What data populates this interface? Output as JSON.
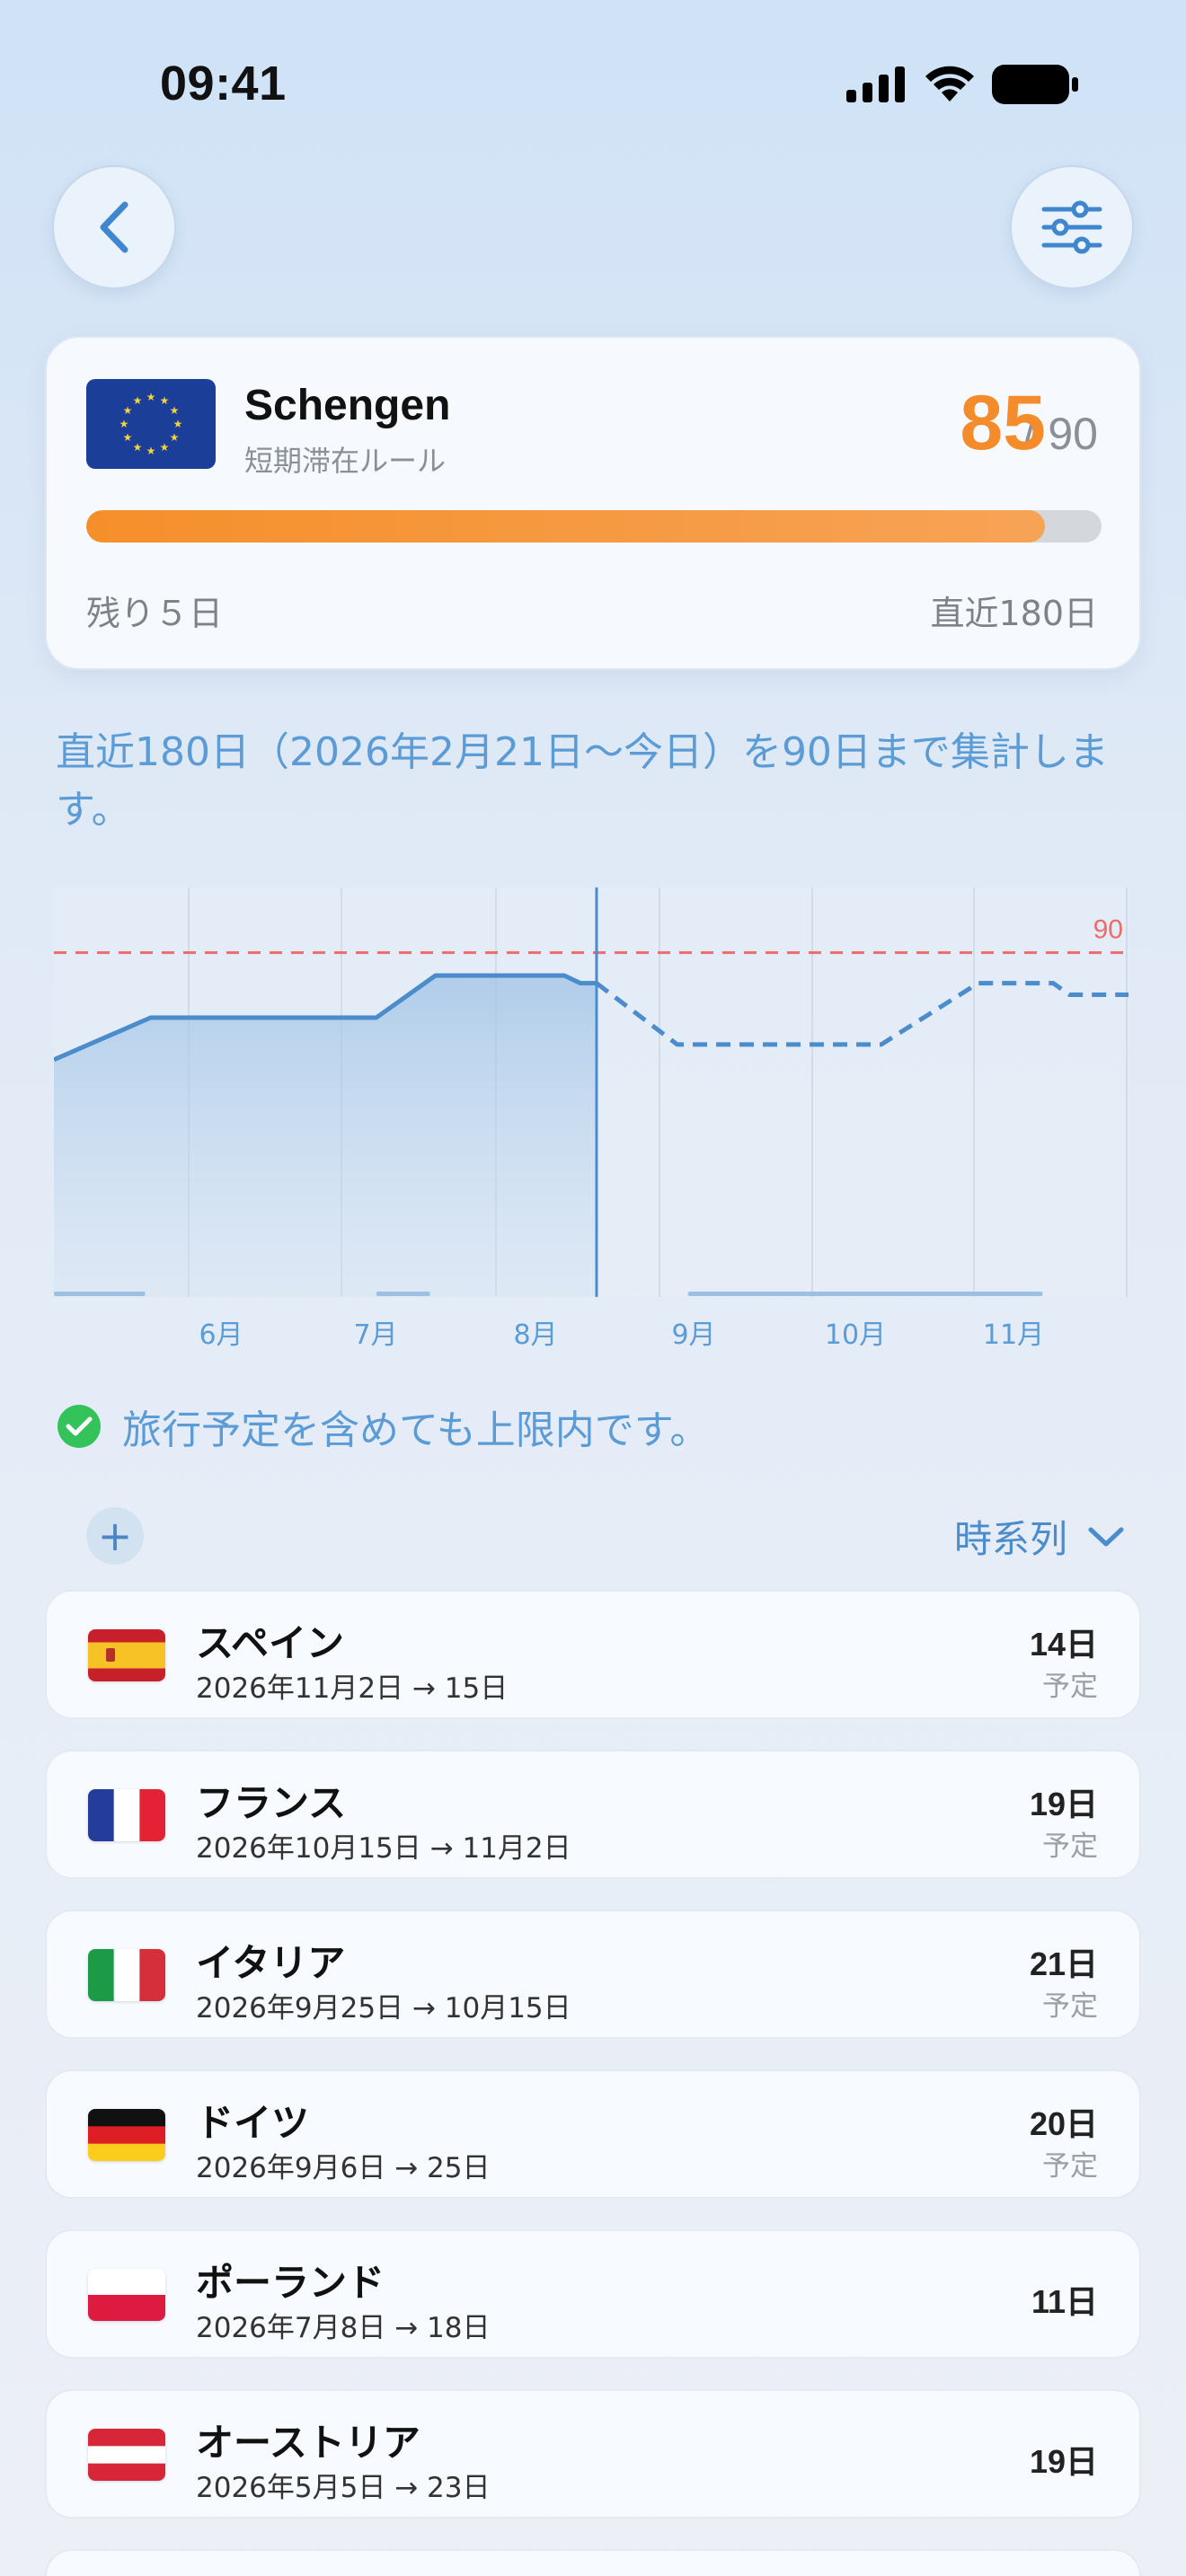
{
  "status_bar": {
    "time": "09:41"
  },
  "nav": {
    "back_icon": "chevron-left-icon",
    "filter_icon": "sliders-icon"
  },
  "summary": {
    "title": "Schengen",
    "subtitle": "短期滞在ルール",
    "used": "85",
    "total": "/ 90",
    "progress_fraction": 0.944,
    "remaining": "残り５日",
    "window": "直近180日",
    "accent_color": "#f48c2b"
  },
  "description": "直近180日（2026年2月21日〜今日）を90日まで集計します。",
  "chart_data": {
    "type": "line",
    "x_labels": [
      "6月",
      "7月",
      "8月",
      "9月",
      "10月",
      "11月"
    ],
    "limit": {
      "value": 90,
      "label": "90",
      "color": "#ec6b6b"
    },
    "today_marker": "today",
    "series": [
      {
        "kind": "actual",
        "style": "solid-filled",
        "color": "#4a8ccc",
        "points": [
          [
            0,
            62
          ],
          [
            0.09,
            73
          ],
          [
            0.3,
            73
          ],
          [
            0.355,
            84
          ],
          [
            0.475,
            84
          ],
          [
            0.49,
            82
          ],
          [
            0.505,
            82
          ]
        ]
      },
      {
        "kind": "projected",
        "style": "dashed",
        "color": "#4a8ccc",
        "points": [
          [
            0.505,
            82
          ],
          [
            0.58,
            66
          ],
          [
            0.77,
            66
          ],
          [
            0.86,
            82
          ],
          [
            0.93,
            82
          ],
          [
            0.945,
            79
          ],
          [
            1.0,
            79
          ]
        ]
      }
    ],
    "ylim": [
      0,
      100
    ],
    "trip_bars": [
      [
        0,
        0.085
      ],
      [
        0.3,
        0.35
      ],
      [
        0.59,
        0.92
      ]
    ]
  },
  "check": {
    "icon": "check-circle-icon",
    "text": "旅行予定を含めても上限内です。"
  },
  "list_controls": {
    "add_label": "+",
    "sort_label": "時系列"
  },
  "trips": [
    {
      "country": "スペイン",
      "dates": "2026年11月2日 → 15日",
      "days": "14日",
      "status": "予定",
      "flag": "spain"
    },
    {
      "country": "フランス",
      "dates": "2026年10月15日 → 11月2日",
      "days": "19日",
      "status": "予定",
      "flag": "france"
    },
    {
      "country": "イタリア",
      "dates": "2026年9月25日 → 10月15日",
      "days": "21日",
      "status": "予定",
      "flag": "italy"
    },
    {
      "country": "ドイツ",
      "dates": "2026年9月6日 → 25日",
      "days": "20日",
      "status": "予定",
      "flag": "germany"
    },
    {
      "country": "ポーランド",
      "dates": "2026年7月8日 → 18日",
      "days": "11日",
      "status": "",
      "flag": "poland"
    },
    {
      "country": "オーストリア",
      "dates": "2026年5月5日 → 23日",
      "days": "19日",
      "status": "",
      "flag": "austria"
    }
  ]
}
